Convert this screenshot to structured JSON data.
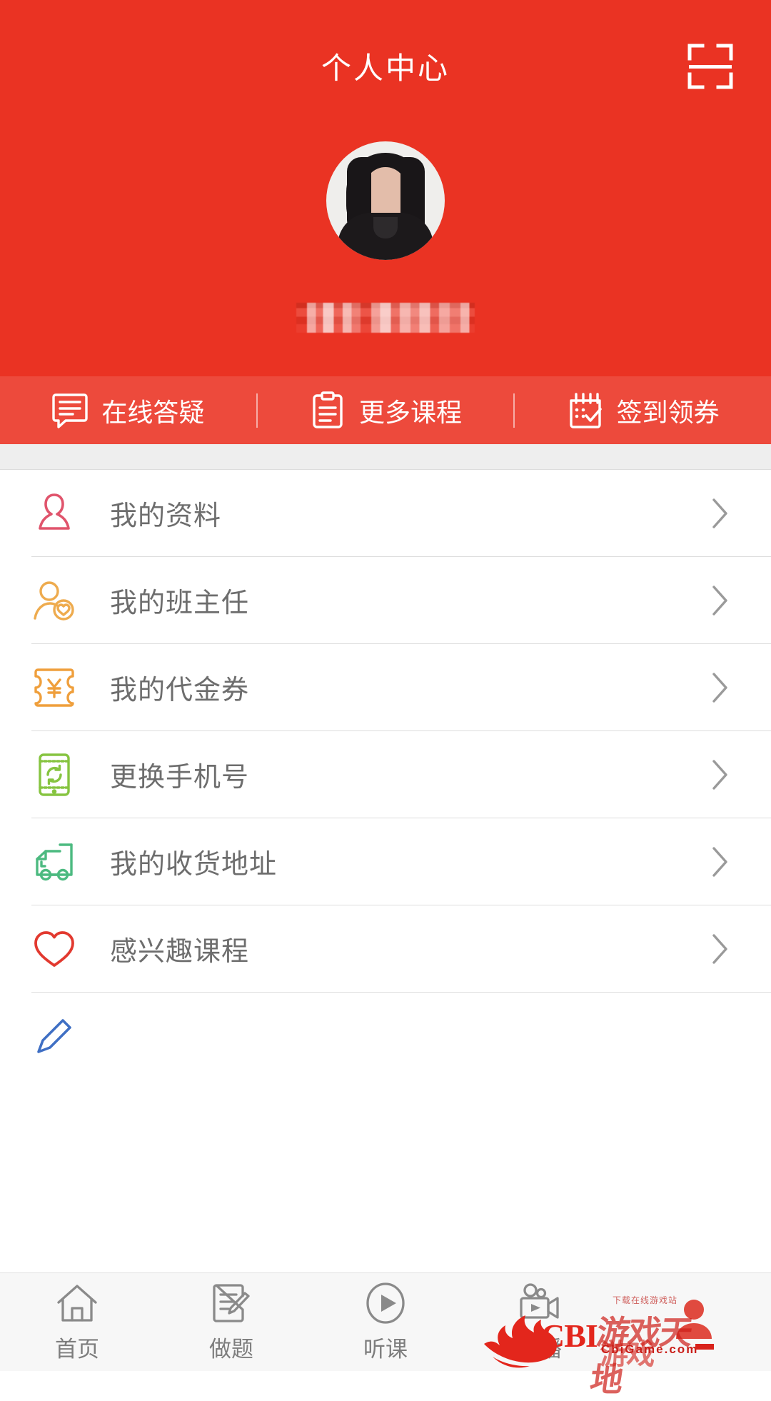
{
  "theme": {
    "brand_red": "#ea3323",
    "quickbar_red": "#ed4a3c",
    "label_gray": "#6d6d6d",
    "divider_gray": "#dddddd",
    "tab_gray": "#7d7d7d",
    "tab_active_red": "#e24b40"
  },
  "header": {
    "title": "个人中心",
    "scan_icon": "scan-qr-icon"
  },
  "profile": {
    "avatar_icon": "user-avatar-photo",
    "username_redacted": "",
    "username_state": "pixelated"
  },
  "quick_actions": [
    {
      "label": "在线答疑",
      "icon": "chat-question-icon"
    },
    {
      "label": "更多课程",
      "icon": "clipboard-list-icon"
    },
    {
      "label": "签到领券",
      "icon": "calendar-check-icon"
    }
  ],
  "menu": {
    "items": [
      {
        "label": "我的资料",
        "icon": "person-outline-icon",
        "icon_color": "#e0546c"
      },
      {
        "label": "我的班主任",
        "icon": "person-heart-icon",
        "icon_color": "#eeab4e"
      },
      {
        "label": "我的代金券",
        "icon": "ticket-yen-icon",
        "icon_color": "#ef9f3c"
      },
      {
        "label": "更换手机号",
        "icon": "phone-refresh-icon",
        "icon_color": "#86c440"
      },
      {
        "label": "我的收货地址",
        "icon": "delivery-truck-icon",
        "icon_color": "#4cba80"
      },
      {
        "label": "感兴趣课程",
        "icon": "heart-outline-icon",
        "icon_color": "#e2392f"
      }
    ],
    "chevron_icon": "chevron-right-icon"
  },
  "tabbar": {
    "tabs": [
      {
        "label": "首页",
        "icon": "home-icon",
        "active": false
      },
      {
        "label": "做题",
        "icon": "note-pencil-icon",
        "active": false
      },
      {
        "label": "听课",
        "icon": "play-circle-icon",
        "active": false
      },
      {
        "label": "直播",
        "icon": "video-camera-icon",
        "active": false
      },
      {
        "label": "",
        "icon": "person-solid-icon",
        "active": true
      }
    ]
  },
  "watermark": {
    "brand": "CBI",
    "cn_name": "游戏天地",
    "cn_name2": "游戏",
    "url": "CbiGame.com",
    "tiny": "下载在线游戏站"
  }
}
